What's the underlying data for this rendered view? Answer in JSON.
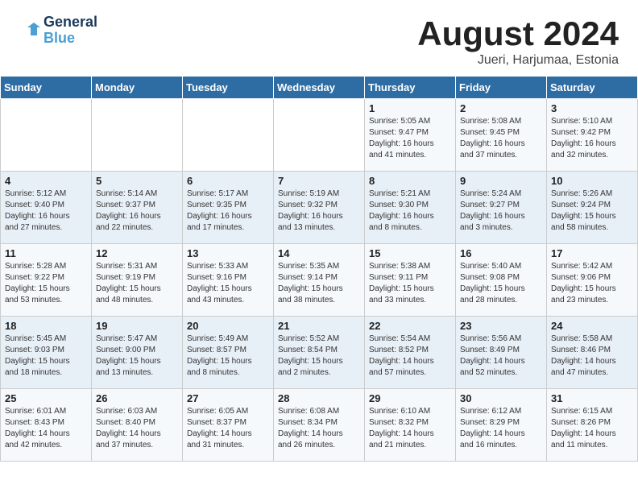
{
  "header": {
    "logo_line1": "General",
    "logo_line2": "Blue",
    "title": "August 2024",
    "subtitle": "Jueri, Harjumaa, Estonia"
  },
  "weekdays": [
    "Sunday",
    "Monday",
    "Tuesday",
    "Wednesday",
    "Thursday",
    "Friday",
    "Saturday"
  ],
  "weeks": [
    [
      {
        "day": "",
        "info": ""
      },
      {
        "day": "",
        "info": ""
      },
      {
        "day": "",
        "info": ""
      },
      {
        "day": "",
        "info": ""
      },
      {
        "day": "1",
        "info": "Sunrise: 5:05 AM\nSunset: 9:47 PM\nDaylight: 16 hours\nand 41 minutes."
      },
      {
        "day": "2",
        "info": "Sunrise: 5:08 AM\nSunset: 9:45 PM\nDaylight: 16 hours\nand 37 minutes."
      },
      {
        "day": "3",
        "info": "Sunrise: 5:10 AM\nSunset: 9:42 PM\nDaylight: 16 hours\nand 32 minutes."
      }
    ],
    [
      {
        "day": "4",
        "info": "Sunrise: 5:12 AM\nSunset: 9:40 PM\nDaylight: 16 hours\nand 27 minutes."
      },
      {
        "day": "5",
        "info": "Sunrise: 5:14 AM\nSunset: 9:37 PM\nDaylight: 16 hours\nand 22 minutes."
      },
      {
        "day": "6",
        "info": "Sunrise: 5:17 AM\nSunset: 9:35 PM\nDaylight: 16 hours\nand 17 minutes."
      },
      {
        "day": "7",
        "info": "Sunrise: 5:19 AM\nSunset: 9:32 PM\nDaylight: 16 hours\nand 13 minutes."
      },
      {
        "day": "8",
        "info": "Sunrise: 5:21 AM\nSunset: 9:30 PM\nDaylight: 16 hours\nand 8 minutes."
      },
      {
        "day": "9",
        "info": "Sunrise: 5:24 AM\nSunset: 9:27 PM\nDaylight: 16 hours\nand 3 minutes."
      },
      {
        "day": "10",
        "info": "Sunrise: 5:26 AM\nSunset: 9:24 PM\nDaylight: 15 hours\nand 58 minutes."
      }
    ],
    [
      {
        "day": "11",
        "info": "Sunrise: 5:28 AM\nSunset: 9:22 PM\nDaylight: 15 hours\nand 53 minutes."
      },
      {
        "day": "12",
        "info": "Sunrise: 5:31 AM\nSunset: 9:19 PM\nDaylight: 15 hours\nand 48 minutes."
      },
      {
        "day": "13",
        "info": "Sunrise: 5:33 AM\nSunset: 9:16 PM\nDaylight: 15 hours\nand 43 minutes."
      },
      {
        "day": "14",
        "info": "Sunrise: 5:35 AM\nSunset: 9:14 PM\nDaylight: 15 hours\nand 38 minutes."
      },
      {
        "day": "15",
        "info": "Sunrise: 5:38 AM\nSunset: 9:11 PM\nDaylight: 15 hours\nand 33 minutes."
      },
      {
        "day": "16",
        "info": "Sunrise: 5:40 AM\nSunset: 9:08 PM\nDaylight: 15 hours\nand 28 minutes."
      },
      {
        "day": "17",
        "info": "Sunrise: 5:42 AM\nSunset: 9:06 PM\nDaylight: 15 hours\nand 23 minutes."
      }
    ],
    [
      {
        "day": "18",
        "info": "Sunrise: 5:45 AM\nSunset: 9:03 PM\nDaylight: 15 hours\nand 18 minutes."
      },
      {
        "day": "19",
        "info": "Sunrise: 5:47 AM\nSunset: 9:00 PM\nDaylight: 15 hours\nand 13 minutes."
      },
      {
        "day": "20",
        "info": "Sunrise: 5:49 AM\nSunset: 8:57 PM\nDaylight: 15 hours\nand 8 minutes."
      },
      {
        "day": "21",
        "info": "Sunrise: 5:52 AM\nSunset: 8:54 PM\nDaylight: 15 hours\nand 2 minutes."
      },
      {
        "day": "22",
        "info": "Sunrise: 5:54 AM\nSunset: 8:52 PM\nDaylight: 14 hours\nand 57 minutes."
      },
      {
        "day": "23",
        "info": "Sunrise: 5:56 AM\nSunset: 8:49 PM\nDaylight: 14 hours\nand 52 minutes."
      },
      {
        "day": "24",
        "info": "Sunrise: 5:58 AM\nSunset: 8:46 PM\nDaylight: 14 hours\nand 47 minutes."
      }
    ],
    [
      {
        "day": "25",
        "info": "Sunrise: 6:01 AM\nSunset: 8:43 PM\nDaylight: 14 hours\nand 42 minutes."
      },
      {
        "day": "26",
        "info": "Sunrise: 6:03 AM\nSunset: 8:40 PM\nDaylight: 14 hours\nand 37 minutes."
      },
      {
        "day": "27",
        "info": "Sunrise: 6:05 AM\nSunset: 8:37 PM\nDaylight: 14 hours\nand 31 minutes."
      },
      {
        "day": "28",
        "info": "Sunrise: 6:08 AM\nSunset: 8:34 PM\nDaylight: 14 hours\nand 26 minutes."
      },
      {
        "day": "29",
        "info": "Sunrise: 6:10 AM\nSunset: 8:32 PM\nDaylight: 14 hours\nand 21 minutes."
      },
      {
        "day": "30",
        "info": "Sunrise: 6:12 AM\nSunset: 8:29 PM\nDaylight: 14 hours\nand 16 minutes."
      },
      {
        "day": "31",
        "info": "Sunrise: 6:15 AM\nSunset: 8:26 PM\nDaylight: 14 hours\nand 11 minutes."
      }
    ]
  ]
}
